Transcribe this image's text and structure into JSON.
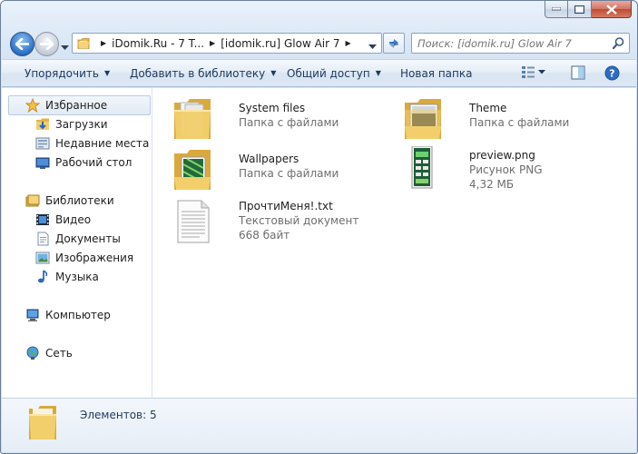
{
  "window": {
    "caption_buttons": [
      "minimize",
      "maximize",
      "close"
    ]
  },
  "address": {
    "crumbs": [
      "iDomik.Ru - 7 T...",
      "[idomik.ru] Glow Air 7"
    ]
  },
  "search": {
    "placeholder": "Поиск: [idomik.ru] Glow Air 7"
  },
  "toolbar": {
    "organize": "Упорядочить",
    "add_to_library": "Добавить в библиотеку",
    "share": "Общий доступ",
    "new_folder": "Новая папка"
  },
  "sidebar": {
    "favorites": {
      "label": "Избранное",
      "items": [
        {
          "label": "Загрузки",
          "icon": "downloads-icon"
        },
        {
          "label": "Недавние места",
          "icon": "recent-places-icon"
        },
        {
          "label": "Рабочий стол",
          "icon": "desktop-icon"
        }
      ]
    },
    "libraries": {
      "label": "Библиотеки",
      "items": [
        {
          "label": "Видео",
          "icon": "video-icon"
        },
        {
          "label": "Документы",
          "icon": "documents-icon"
        },
        {
          "label": "Изображения",
          "icon": "pictures-icon"
        },
        {
          "label": "Музыка",
          "icon": "music-icon"
        }
      ]
    },
    "computer": {
      "label": "Компьютер"
    },
    "network": {
      "label": "Сеть"
    }
  },
  "files": [
    {
      "name": "System files",
      "type": "Папка с файлами",
      "size": ""
    },
    {
      "name": "Theme",
      "type": "Папка с файлами",
      "size": ""
    },
    {
      "name": "Wallpapers",
      "type": "Папка с файлами",
      "size": ""
    },
    {
      "name": "preview.png",
      "type": "Рисунок PNG",
      "size": "4,32 МБ"
    },
    {
      "name": "ПрочтиМеня!.txt",
      "type": "Текстовый документ",
      "size": "668 байт"
    }
  ],
  "details": {
    "count": "Элементов: 5"
  },
  "colors": {
    "accent": "#1e395b",
    "folder": "#f2cf6b",
    "selection": "#e2eaf3"
  }
}
